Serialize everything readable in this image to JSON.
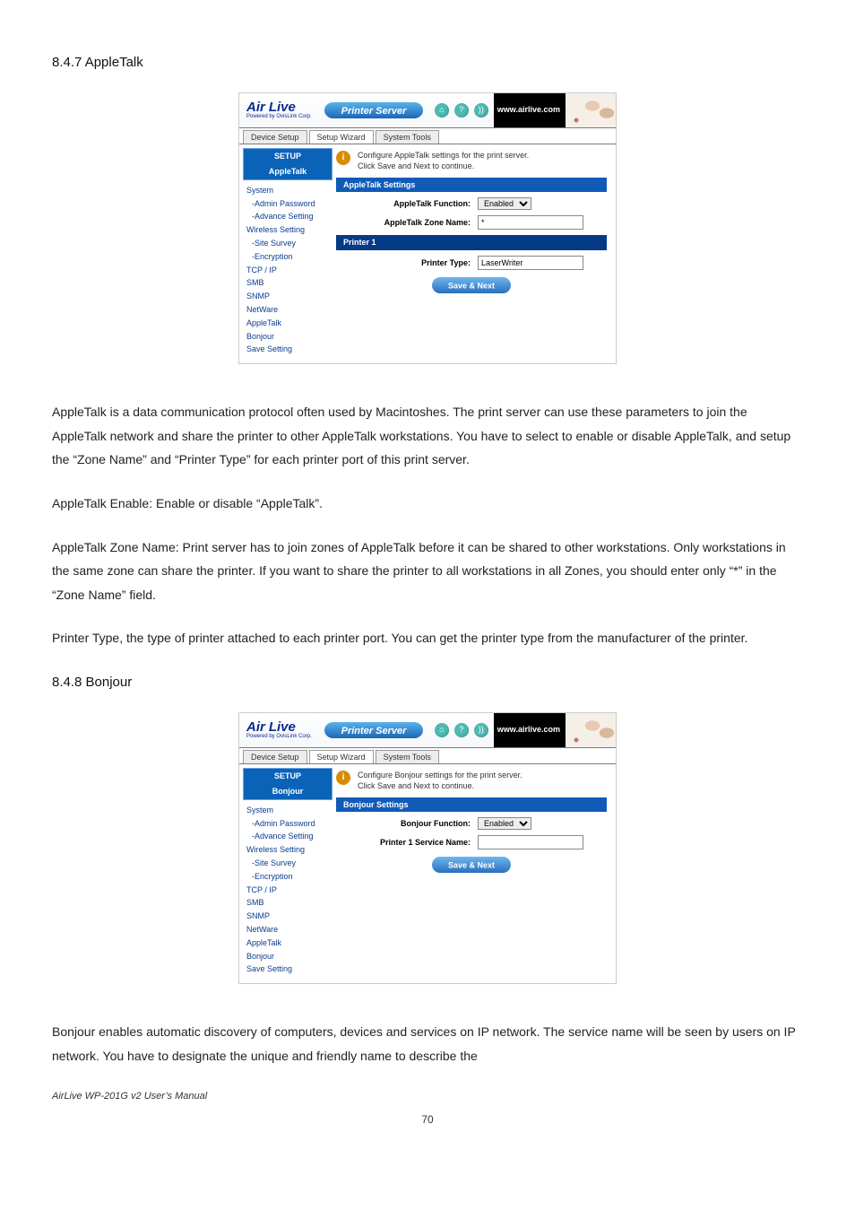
{
  "sections": {
    "at_heading": "8.4.7 AppleTalk",
    "bj_heading": "8.4.8 Bonjour"
  },
  "paragraphs": {
    "at_main": "AppleTalk is a data communication protocol often used by Macintoshes. The print server can use these parameters to join the AppleTalk network and share the printer to other AppleTalk workstations. You have to select to enable or disable AppleTalk, and setup the “Zone Name” and “Printer Type” for each printer port of this print server.",
    "at_enable": "AppleTalk Enable: Enable or disable “AppleTalk”.",
    "at_zone": "AppleTalk Zone Name: Print server has to join zones of AppleTalk before it can be shared to other workstations. Only workstations in the same zone can share the printer. If you want to share the printer to all workstations in all Zones, you should enter only “*” in the “Zone Name” field.",
    "at_ptype": "Printer Type, the type of printer attached to each printer port. You can get the printer type from the manufacturer of the printer.",
    "bj_main": "Bonjour enables automatic discovery of computers, devices and services on IP network. The service name will be seen by users on IP network. You have to designate the unique and friendly name to describe the"
  },
  "footer": "AirLive WP-201G v2 User’s Manual",
  "pagenum": "70",
  "shot_common": {
    "logo_text1": "Air",
    "logo_text2": "Live",
    "logo_sub": "Powered by OvisLink Corp.",
    "title": "Printer Server",
    "url": "www.airlive.com",
    "tabs": {
      "t1": "Device Setup",
      "t2": "Setup Wizard",
      "t3": "System Tools"
    },
    "nav": {
      "setup": "SETUP",
      "items": {
        "system": "System",
        "admin": "-Admin Password",
        "advance": "-Advance Setting",
        "wireless": "Wireless Setting",
        "site": "-Site Survey",
        "encrypt": "-Encryption",
        "tcpip": "TCP / IP",
        "smb": "SMB",
        "snmp": "SNMP",
        "netware": "NetWare",
        "appletalk": "AppleTalk",
        "bonjour": "Bonjour",
        "save": "Save Setting"
      }
    },
    "save_btn": "Save & Next"
  },
  "shot_at": {
    "current": "AppleTalk",
    "info": "Configure AppleTalk settings for the print server.\nClick Save and Next to continue.",
    "bar1": "AppleTalk Settings",
    "func_label": "AppleTalk Function:",
    "func_value": "Enabled",
    "zone_label": "AppleTalk Zone Name:",
    "zone_value": "*",
    "bar2": "Printer 1",
    "ptype_label": "Printer Type:",
    "ptype_value": "LaserWriter"
  },
  "shot_bj": {
    "current": "Bonjour",
    "info": "Configure Bonjour settings for the print server.\nClick Save and Next to continue.",
    "bar1": "Bonjour Settings",
    "func_label": "Bonjour Function:",
    "func_value": "Enabled",
    "svc_label": "Printer 1 Service Name:",
    "svc_value": ""
  }
}
